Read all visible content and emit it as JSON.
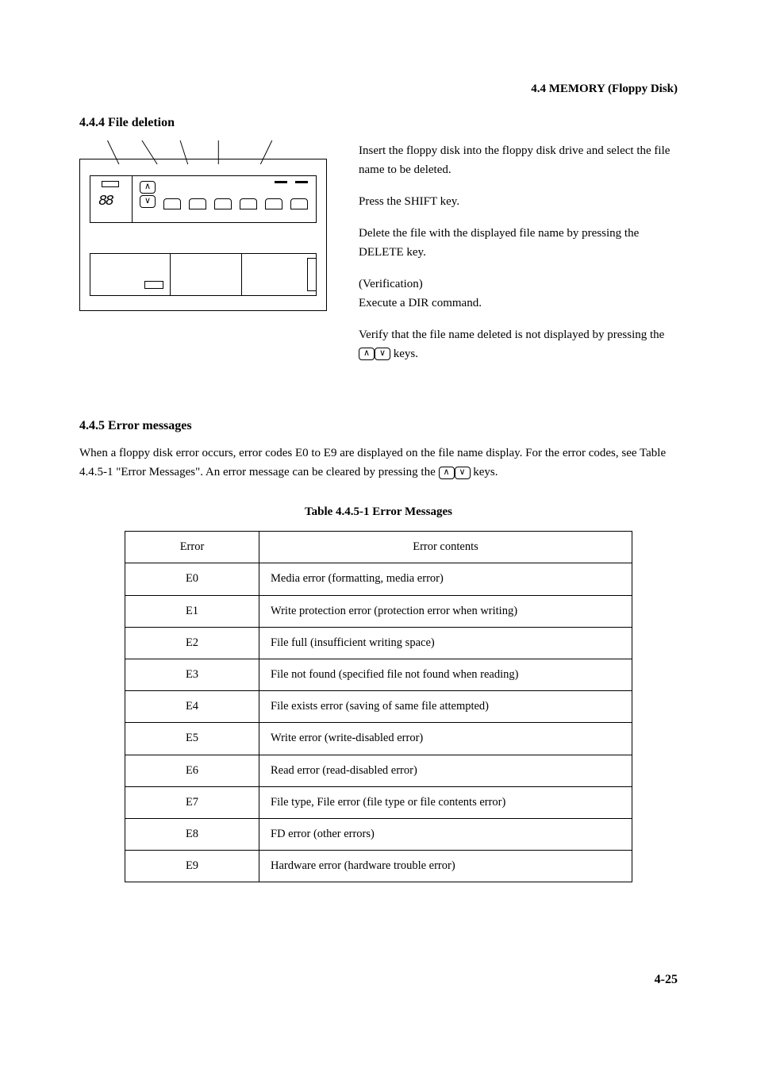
{
  "header": {
    "running_head": "4.4  MEMORY (Floppy Disk)"
  },
  "section_444": {
    "heading": "4.4.4  File deletion",
    "paragraphs": {
      "p1": "Insert the floppy disk into the floppy disk drive and select the file name to be deleted.",
      "p2": "Press the SHIFT key.",
      "p3": "Delete the file with the displayed file name by pressing the DELETE key.",
      "p4a": "(Verification)",
      "p4b": "Execute a DIR command.",
      "p5_prefix": "Verify that the file name deleted is not displayed by pressing the ",
      "p5_suffix": " keys."
    },
    "figure": {
      "display": "88"
    }
  },
  "section_445": {
    "heading": "4.4.5  Error messages",
    "intro_prefix": "When a floppy disk error occurs, error codes E0 to E9 are displayed on the file name display. For the error codes, see Table 4.4.5-1 \"Error Messages\". An error message can be cleared by pressing the ",
    "intro_suffix": " keys.",
    "table_caption": "Table 4.4.5-1  Error Messages",
    "table_headers": {
      "col1": "Error",
      "col2": "Error contents"
    },
    "rows": [
      {
        "code": "E0",
        "desc": "Media error (formatting, media error)"
      },
      {
        "code": "E1",
        "desc": "Write protection error (protection error when writing)"
      },
      {
        "code": "E2",
        "desc": "File full (insufficient writing space)"
      },
      {
        "code": "E3",
        "desc": "File not found (specified file not found when reading)"
      },
      {
        "code": "E4",
        "desc": "File exists error (saving of same file attempted)"
      },
      {
        "code": "E5",
        "desc": "Write error (write-disabled error)"
      },
      {
        "code": "E6",
        "desc": "Read error (read-disabled error)"
      },
      {
        "code": "E7",
        "desc": "File type, File error (file type or file contents error)"
      },
      {
        "code": "E8",
        "desc": "FD error (other errors)"
      },
      {
        "code": "E9",
        "desc": "Hardware error (hardware trouble error)"
      }
    ]
  },
  "keys": {
    "up_glyph": "∧",
    "down_glyph": "∨"
  },
  "footer": {
    "page": "4-25"
  }
}
